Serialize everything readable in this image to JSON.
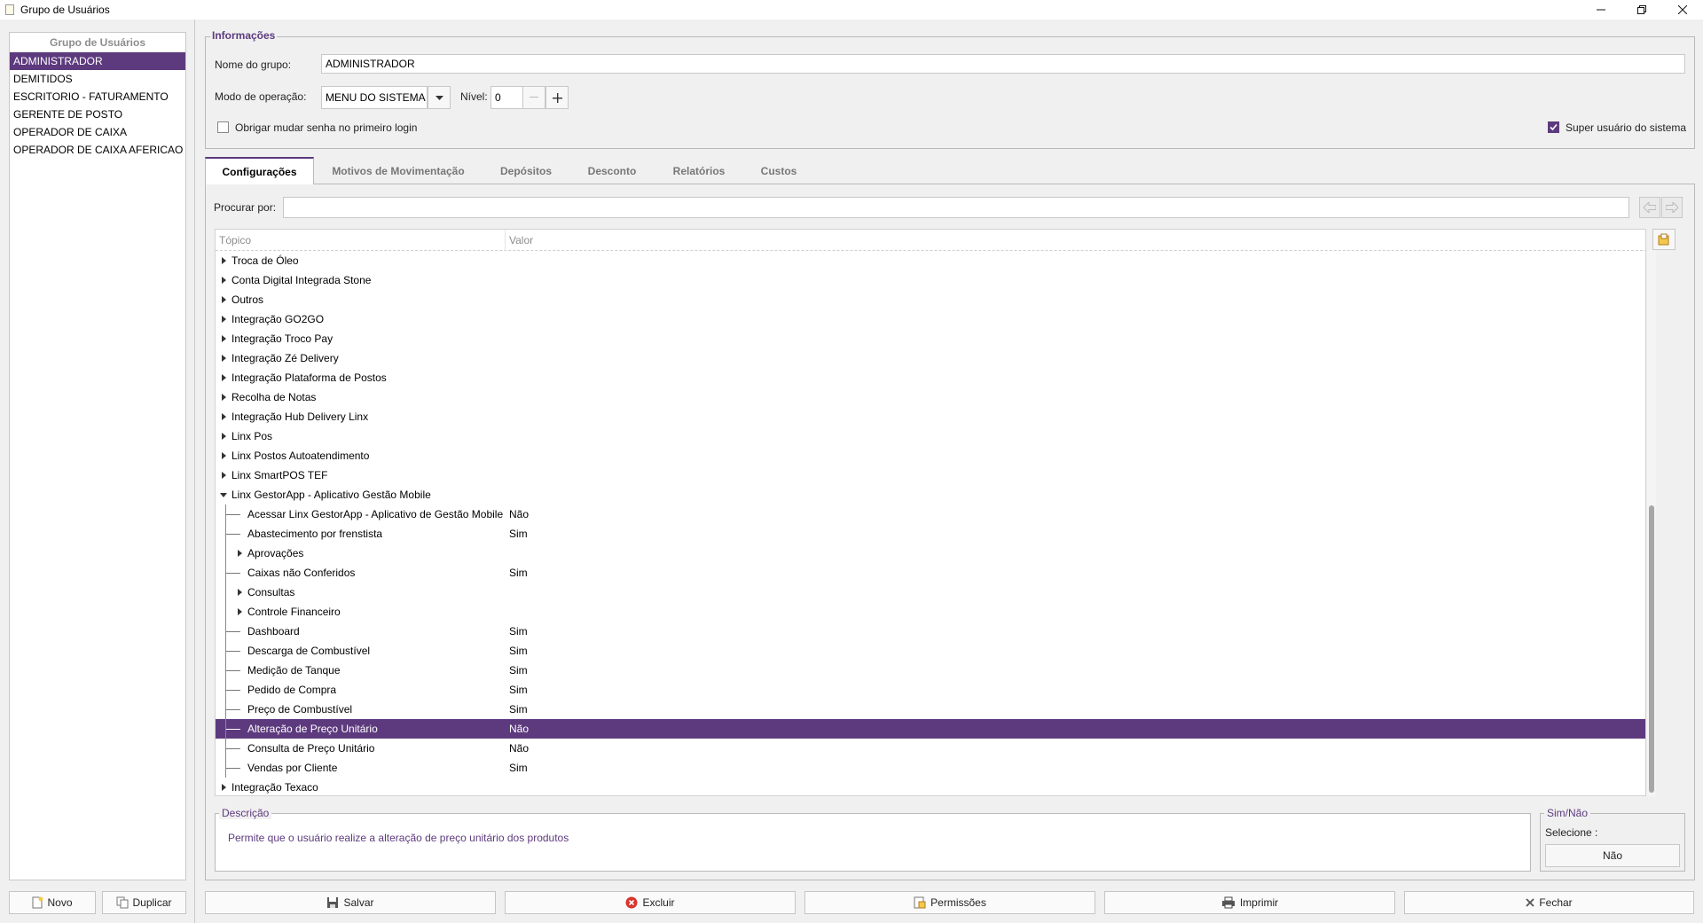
{
  "window": {
    "title": "Grupo de Usuários"
  },
  "left_panel": {
    "header": "Grupo de Usuários",
    "groups": [
      {
        "label": "ADMINISTRADOR",
        "selected": true
      },
      {
        "label": "DEMITIDOS",
        "selected": false
      },
      {
        "label": "ESCRITORIO - FATURAMENTO",
        "selected": false
      },
      {
        "label": "GERENTE DE POSTO",
        "selected": false
      },
      {
        "label": "OPERADOR DE CAIXA",
        "selected": false
      },
      {
        "label": "OPERADOR DE CAIXA AFERICAO",
        "selected": false
      }
    ],
    "novo_label": "Novo",
    "duplicar_label": "Duplicar"
  },
  "info": {
    "legend": "Informações",
    "nome_label": "Nome do grupo:",
    "nome_value": "ADMINISTRADOR",
    "modo_label": "Modo de operação:",
    "modo_value": "MENU DO SISTEMA",
    "nivel_label": "Nível:",
    "nivel_value": "0",
    "obrigar_label": "Obrigar mudar senha no primeiro login",
    "obrigar_checked": false,
    "super_label": "Super usuário do sistema",
    "super_checked": true
  },
  "tabs": [
    {
      "label": "Configurações",
      "active": true
    },
    {
      "label": "Motivos de Movimentação",
      "active": false
    },
    {
      "label": "Depósitos",
      "active": false
    },
    {
      "label": "Desconto",
      "active": false
    },
    {
      "label": "Relatórios",
      "active": false
    },
    {
      "label": "Custos",
      "active": false
    }
  ],
  "search": {
    "label": "Procurar por:",
    "value": ""
  },
  "tree": {
    "col_topico": "Tópico",
    "col_valor": "Valor",
    "rows": [
      {
        "label": "Troca de Óleo",
        "level": 0,
        "exp": "collapsed",
        "value": ""
      },
      {
        "label": "Conta Digital Integrada Stone",
        "level": 0,
        "exp": "collapsed",
        "value": ""
      },
      {
        "label": "Outros",
        "level": 0,
        "exp": "collapsed",
        "value": ""
      },
      {
        "label": "Integração GO2GO",
        "level": 0,
        "exp": "collapsed",
        "value": ""
      },
      {
        "label": "Integração Troco Pay",
        "level": 0,
        "exp": "collapsed",
        "value": ""
      },
      {
        "label": "Integração Zé Delivery",
        "level": 0,
        "exp": "collapsed",
        "value": ""
      },
      {
        "label": "Integração Plataforma de Postos",
        "level": 0,
        "exp": "collapsed",
        "value": ""
      },
      {
        "label": "Recolha de Notas",
        "level": 0,
        "exp": "collapsed",
        "value": ""
      },
      {
        "label": "Integração Hub Delivery Linx",
        "level": 0,
        "exp": "collapsed",
        "value": ""
      },
      {
        "label": "Linx Pos",
        "level": 0,
        "exp": "collapsed",
        "value": ""
      },
      {
        "label": "Linx Postos Autoatendimento",
        "level": 0,
        "exp": "collapsed",
        "value": ""
      },
      {
        "label": "Linx SmartPOS TEF",
        "level": 0,
        "exp": "collapsed",
        "value": ""
      },
      {
        "label": "Linx GestorApp - Aplicativo Gestão Mobile",
        "level": 0,
        "exp": "expanded",
        "value": ""
      },
      {
        "label": "Acessar Linx GestorApp - Aplicativo de Gestão Mobile",
        "level": 1,
        "exp": "leaf",
        "value": "Não"
      },
      {
        "label": "Abastecimento por frenstista",
        "level": 1,
        "exp": "leaf",
        "value": "Sim"
      },
      {
        "label": "Aprovações",
        "level": 1,
        "exp": "collapsed",
        "value": ""
      },
      {
        "label": "Caixas não Conferidos",
        "level": 1,
        "exp": "leaf",
        "value": "Sim"
      },
      {
        "label": "Consultas",
        "level": 1,
        "exp": "collapsed",
        "value": ""
      },
      {
        "label": "Controle Financeiro",
        "level": 1,
        "exp": "collapsed",
        "value": ""
      },
      {
        "label": "Dashboard",
        "level": 1,
        "exp": "leaf",
        "value": "Sim"
      },
      {
        "label": "Descarga de Combustível",
        "level": 1,
        "exp": "leaf",
        "value": "Sim"
      },
      {
        "label": "Medição de Tanque",
        "level": 1,
        "exp": "leaf",
        "value": "Sim"
      },
      {
        "label": "Pedido de Compra",
        "level": 1,
        "exp": "leaf",
        "value": "Sim"
      },
      {
        "label": "Preço de Combustível",
        "level": 1,
        "exp": "leaf",
        "value": "Sim"
      },
      {
        "label": "Alteração de Preço Unitário",
        "level": 1,
        "exp": "leaf",
        "value": "Não",
        "selected": true
      },
      {
        "label": "Consulta de Preço Unitário",
        "level": 1,
        "exp": "leaf",
        "value": "Não"
      },
      {
        "label": "Vendas por Cliente",
        "level": 1,
        "exp": "leaf",
        "value": "Sim"
      },
      {
        "label": "Integração Texaco",
        "level": 0,
        "exp": "collapsed",
        "value": ""
      }
    ]
  },
  "descricao": {
    "legend": "Descrição",
    "text": "Permite que o usuário realize a alteração de preço unitário dos produtos"
  },
  "simnao": {
    "legend": "Sim/Não",
    "selecione_label": "Selecione :",
    "button_label": "Não"
  },
  "bottom_buttons": {
    "salvar": "Salvar",
    "excluir": "Excluir",
    "permissoes": "Permissões",
    "imprimir": "Imprimir",
    "fechar": "Fechar"
  },
  "colors": {
    "accent": "#5d3a7e",
    "excluir_icon": "#d9342b"
  }
}
